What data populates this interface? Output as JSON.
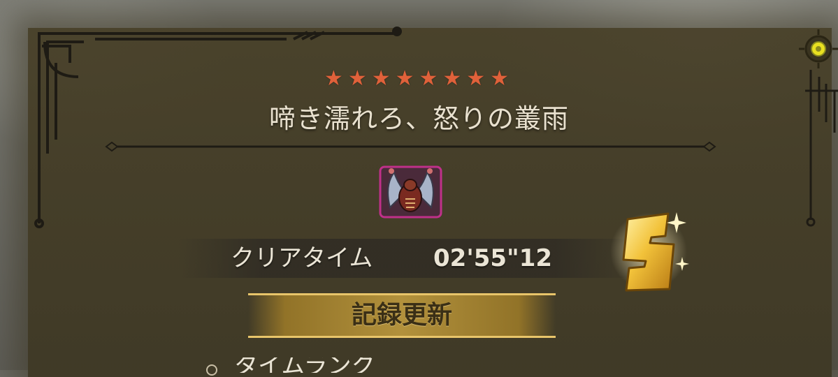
{
  "quest": {
    "stars": "★★★★★★★★",
    "star_count": 8,
    "title": "啼き濡れろ、怒りの叢雨"
  },
  "result": {
    "clear_label": "クリアタイム",
    "clear_time": "02'55\"12",
    "rank": "S",
    "record_label": "記録更新"
  },
  "next_section": {
    "label": "タイムランク"
  },
  "colors": {
    "star": "#e0613a",
    "accent_gold": "#e8c56a",
    "text": "#ebe5d6"
  },
  "icons": {
    "monster": "monster-icon",
    "rank_badge": "rank-s-badge",
    "compass": "compass-icon"
  }
}
